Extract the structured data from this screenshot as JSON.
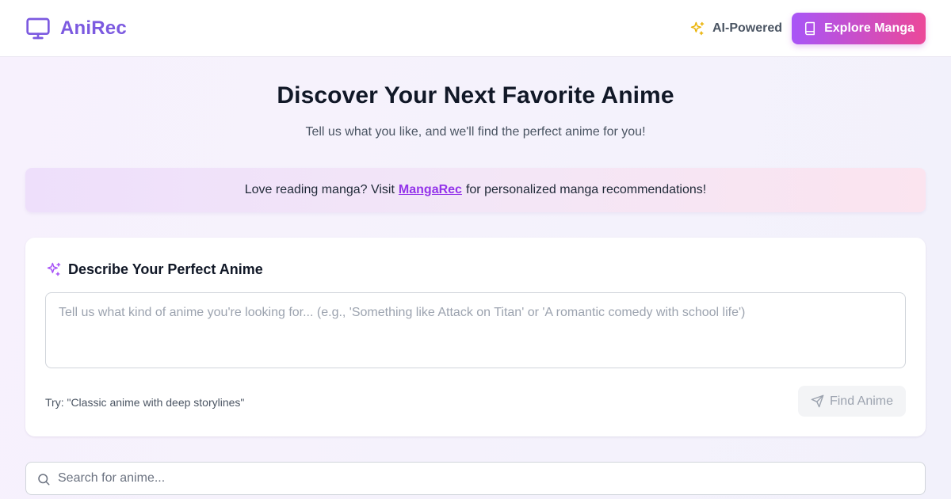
{
  "header": {
    "brand_name": "AniRec",
    "brand_icon": "tv-icon",
    "ai_badge_label": "AI-Powered",
    "ai_badge_icon": "sparkles-icon",
    "explore_button_label": "Explore Manga",
    "explore_button_icon": "book-icon"
  },
  "hero": {
    "title": "Discover Your Next Favorite Anime",
    "subtitle": "Tell us what you like, and we'll find the perfect anime for you!"
  },
  "promo": {
    "text_before": "Love reading manga? Visit",
    "link_label": "MangaRec",
    "text_after": "for personalized manga recommendations!"
  },
  "describe_card": {
    "heading": "Describe Your Perfect Anime",
    "heading_icon": "sparkles-icon",
    "textarea_value": "",
    "textarea_placeholder": "Tell us what kind of anime you're looking for... (e.g., 'Something like Attack on Titan' or 'A romantic comedy with school life')",
    "try_hint": "Try: \"Classic anime with deep storylines\"",
    "submit_label": "Find Anime",
    "submit_icon": "send-icon",
    "submit_enabled": false
  },
  "search": {
    "value": "",
    "placeholder": "Search for anime...",
    "icon": "search-icon"
  },
  "colors": {
    "brand": "#7c5ae0",
    "gradient_start": "#a855f7",
    "gradient_end": "#ec4899",
    "link": "#9333ea",
    "ai_icon": "#eab308"
  }
}
